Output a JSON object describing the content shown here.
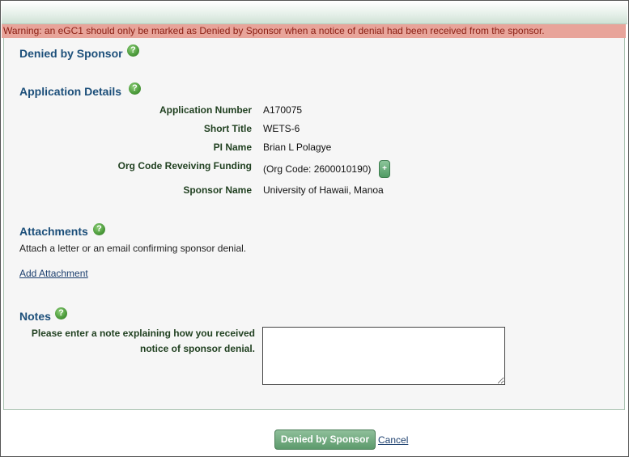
{
  "warning": "Warning: an eGC1 should only be marked as Denied by Sponsor when a notice of denial had been received from the sponsor.",
  "sections": {
    "denied": "Denied by Sponsor",
    "application_details": "Application Details",
    "attachments": "Attachments",
    "notes": "Notes"
  },
  "help_icon_glyph": "?",
  "details": {
    "application_number": {
      "label": "Application Number",
      "value": "A170075"
    },
    "short_title": {
      "label": "Short Title",
      "value": "WETS-6"
    },
    "pi_name": {
      "label": "PI Name",
      "value": "Brian L Polagye"
    },
    "org_code": {
      "label": "Org Code Reveiving Funding",
      "value": "(Org Code: 2600010190)",
      "expand_label": "+"
    },
    "sponsor_name": {
      "label": "Sponsor Name",
      "value": "University of Hawaii, Manoa"
    }
  },
  "attachments": {
    "description": "Attach a letter or an email confirming sponsor denial.",
    "add_link": "Add Attachment"
  },
  "notes": {
    "label_line1": "Please enter a note explaining how you received",
    "label_line2": "notice of sponsor denial.",
    "value": ""
  },
  "footer": {
    "submit_label": "Denied by Sponsor",
    "cancel_label": "Cancel"
  },
  "colors": {
    "warning_bg": "#e8a49a",
    "section_title": "#1c4f7a",
    "button_green": "#5c9a6c"
  }
}
